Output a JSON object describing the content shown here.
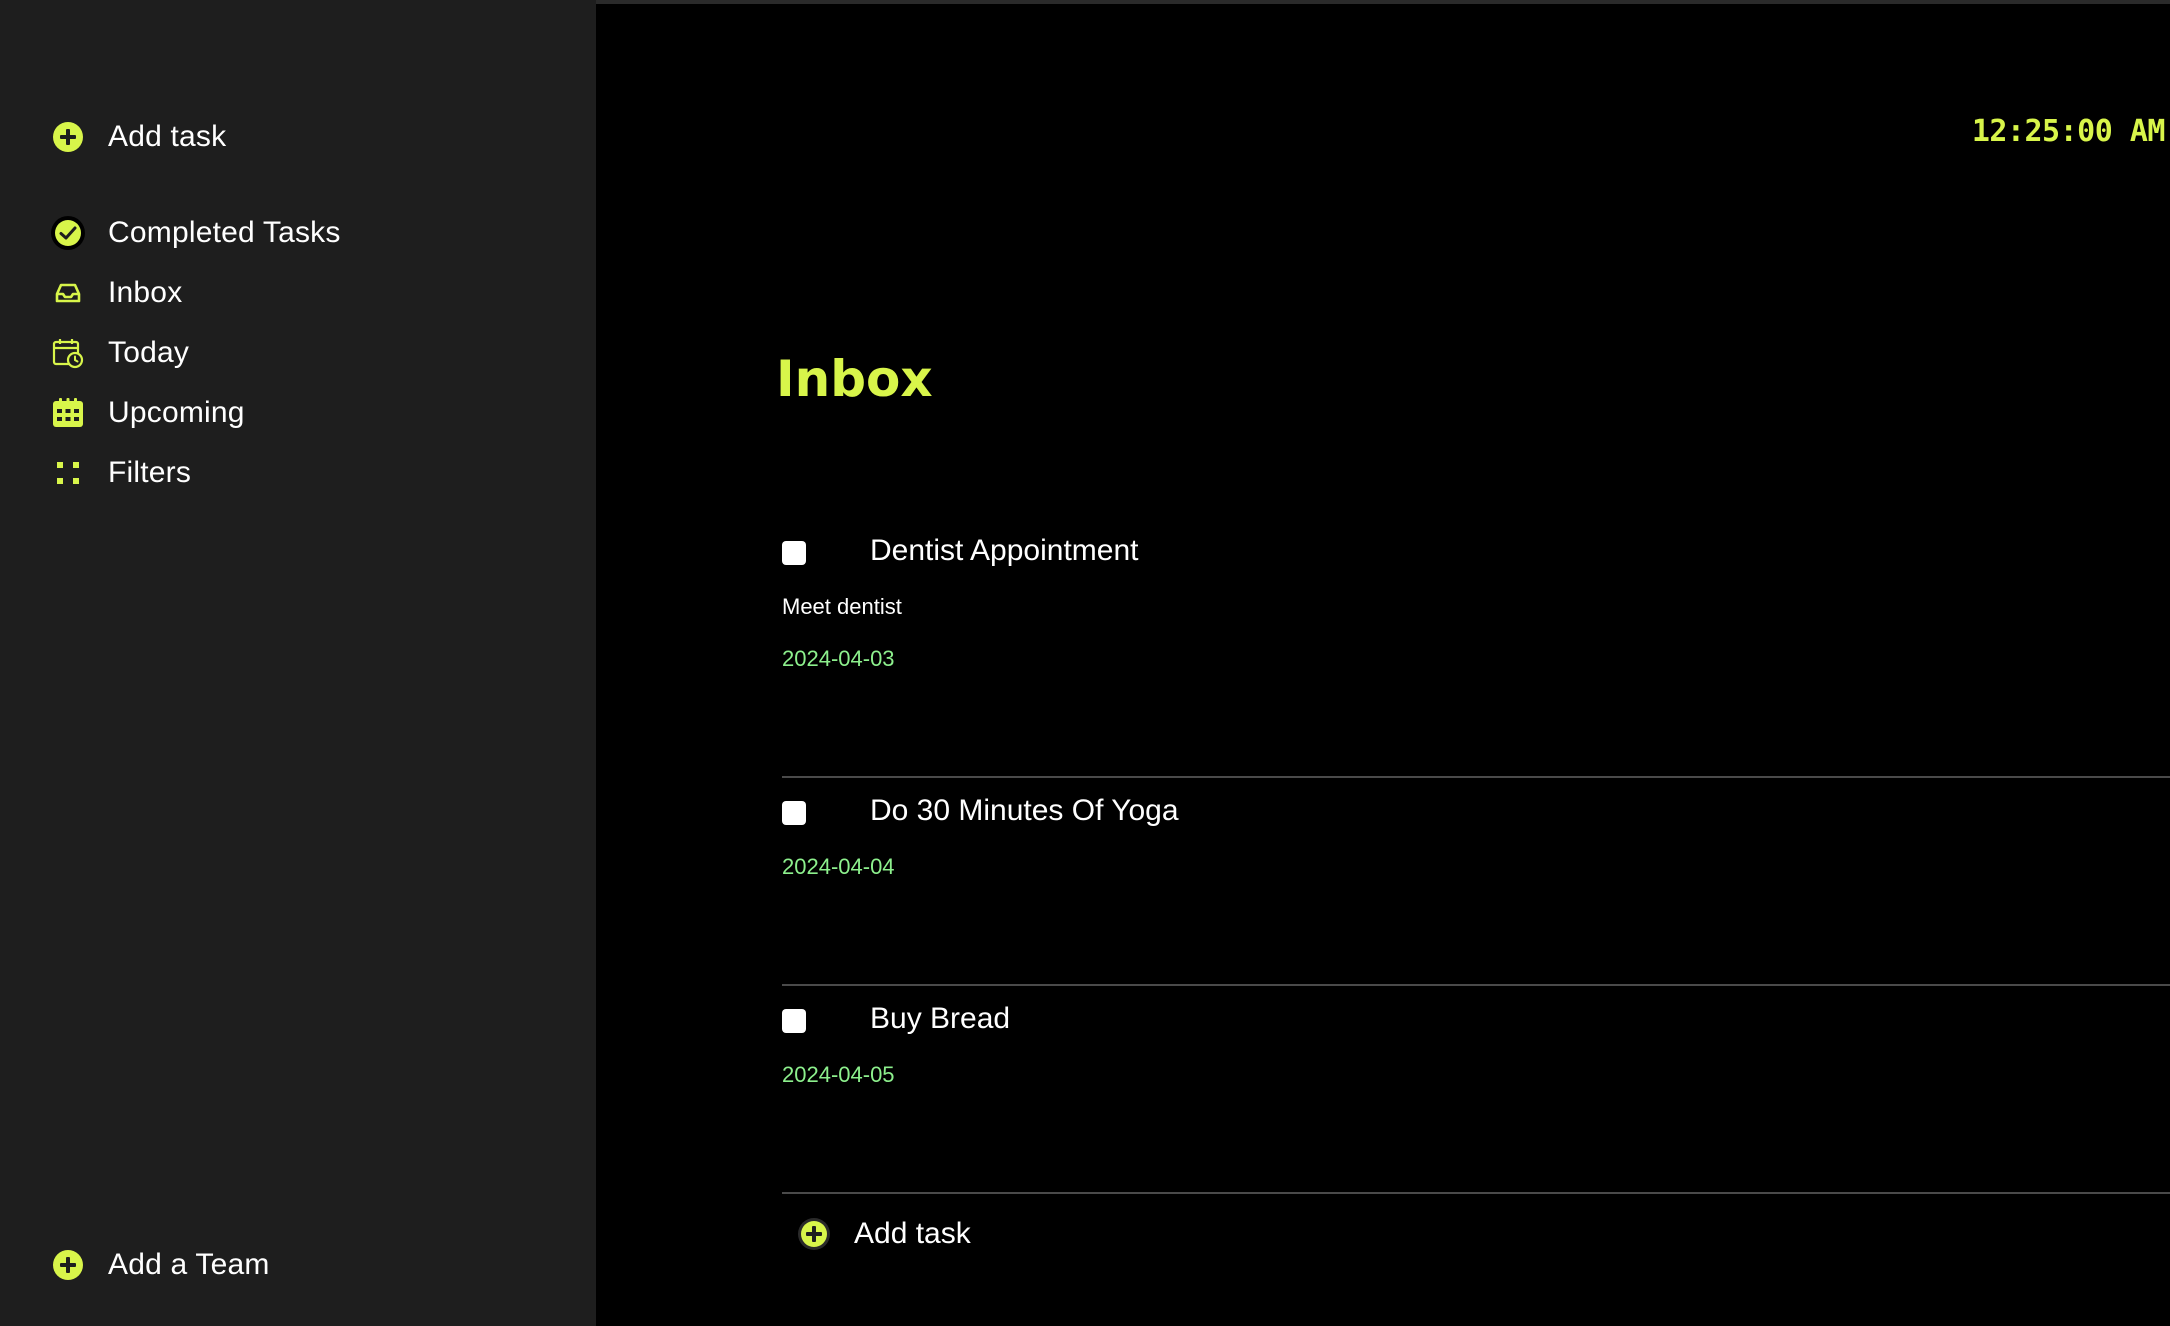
{
  "colors": {
    "accent": "#d8f54a",
    "date": "#8df08d",
    "sidebar_bg": "#1e1e1e",
    "main_bg": "#000000",
    "text": "#ffffff"
  },
  "sidebar": {
    "add_task": {
      "label": "Add task",
      "icon": "plus-circle-icon"
    },
    "items": [
      {
        "label": "Completed Tasks",
        "icon": "check-circle-icon"
      },
      {
        "label": "Inbox",
        "icon": "inbox-icon"
      },
      {
        "label": "Today",
        "icon": "calendar-clock-icon"
      },
      {
        "label": "Upcoming",
        "icon": "calendar-grid-icon"
      },
      {
        "label": "Filters",
        "icon": "filters-grid-icon"
      }
    ],
    "add_team": {
      "label": "Add a Team",
      "icon": "plus-circle-icon"
    }
  },
  "header": {
    "clock": "12:25:00 AM"
  },
  "main": {
    "title": "Inbox",
    "tasks": [
      {
        "title": "Dentist Appointment",
        "description": "Meet dentist",
        "date": "2024-04-03",
        "checked": false
      },
      {
        "title": "Do 30 Minutes Of Yoga",
        "description": "",
        "date": "2024-04-04",
        "checked": false
      },
      {
        "title": "Buy Bread",
        "description": "",
        "date": "2024-04-05",
        "checked": false
      }
    ],
    "add_task_label": "Add task"
  }
}
